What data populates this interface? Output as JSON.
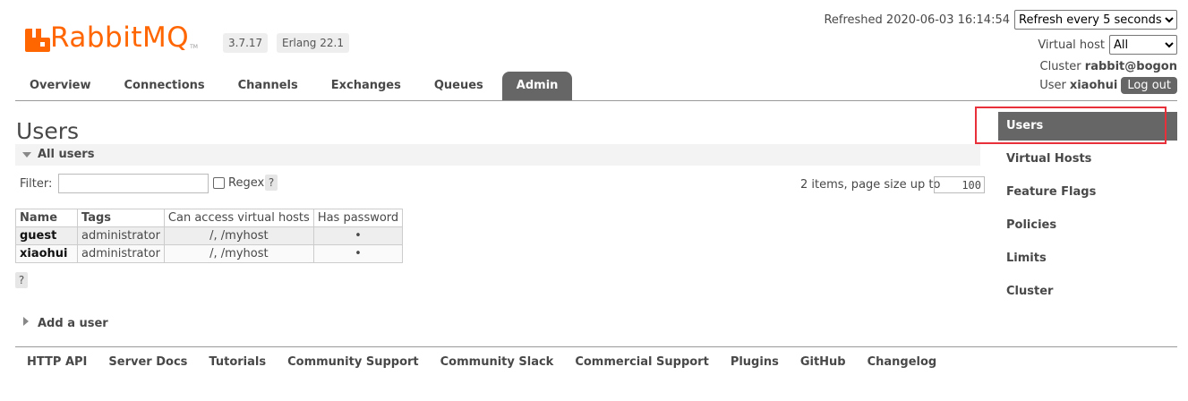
{
  "app": {
    "logo_text": "RabbitMQ",
    "logo_tm": "TM",
    "version": "3.7.17",
    "erlang": "Erlang 22.1",
    "brand_color": "#ff6600"
  },
  "status": {
    "refreshed_label": "Refreshed 2020-06-03 16:14:54",
    "refresh_select": "Refresh every 5 seconds",
    "vhost_label": "Virtual host",
    "vhost_select": "All",
    "cluster_label": "Cluster",
    "cluster_name": "rabbit@bogon",
    "user_label": "User",
    "user_name": "xiaohui",
    "logout": "Log out"
  },
  "tabs": [
    {
      "label": "Overview"
    },
    {
      "label": "Connections"
    },
    {
      "label": "Channels"
    },
    {
      "label": "Exchanges"
    },
    {
      "label": "Queues"
    },
    {
      "label": "Admin",
      "active": true
    }
  ],
  "page": {
    "title": "Users",
    "section_all": "All users",
    "filter_label": "Filter:",
    "filter_value": "",
    "regex_label": "Regex",
    "help": "?",
    "items_text": "2 items, page size up to",
    "page_size": "100",
    "add_user": "Add a user"
  },
  "table": {
    "headers": [
      "Name",
      "Tags",
      "Can access virtual hosts",
      "Has password"
    ],
    "rows": [
      {
        "name": "guest",
        "tags": "administrator",
        "vhosts": "/, /myhost",
        "has_password": "•"
      },
      {
        "name": "xiaohui",
        "tags": "administrator",
        "vhosts": "/, /myhost",
        "has_password": "•"
      }
    ]
  },
  "sidebar": {
    "items": [
      {
        "label": "Users",
        "active": true
      },
      {
        "label": "Virtual Hosts"
      },
      {
        "label": "Feature Flags"
      },
      {
        "label": "Policies"
      },
      {
        "label": "Limits"
      },
      {
        "label": "Cluster"
      }
    ]
  },
  "footer": {
    "links": [
      "HTTP API",
      "Server Docs",
      "Tutorials",
      "Community Support",
      "Community Slack",
      "Commercial Support",
      "Plugins",
      "GitHub",
      "Changelog"
    ]
  },
  "colors": {
    "tab_active_bg": "#666666",
    "highlight_border": "#e8303b"
  }
}
